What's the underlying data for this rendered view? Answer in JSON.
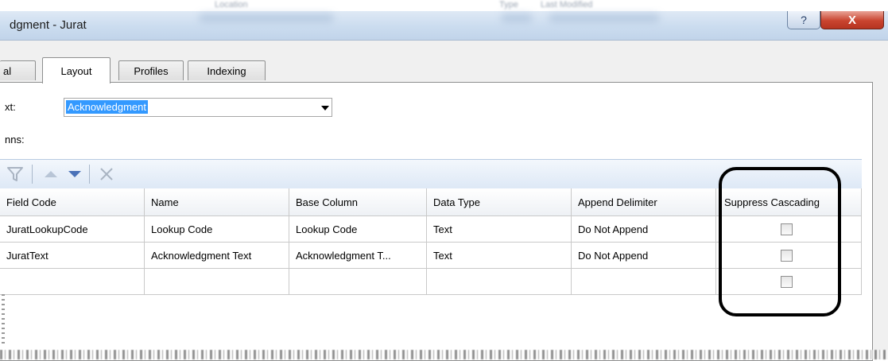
{
  "background_header": [
    "Location",
    "Type",
    "Last Modified"
  ],
  "window": {
    "title": "dgment - Jurat",
    "help_symbol": "?",
    "close_symbol": "X"
  },
  "tabs": [
    {
      "label": "al"
    },
    {
      "label": "Layout",
      "active": true
    },
    {
      "label": "Profiles"
    },
    {
      "label": "Indexing"
    }
  ],
  "form": {
    "text_label": "xt:",
    "text_value": "Acknowledgment",
    "columns_label": "nns:"
  },
  "grid": {
    "headers": [
      "Field Code",
      "Name",
      "Base Column",
      "Data Type",
      "Append Delimiter",
      "Suppress Cascading"
    ],
    "rows": [
      {
        "field_code": "JuratLookupCode",
        "name": "Lookup Code",
        "base_column": "Lookup Code",
        "data_type": "Text",
        "append_delimiter": "Do Not Append",
        "suppress_cascading": false
      },
      {
        "field_code": "JuratText",
        "name": "Acknowledgment Text",
        "base_column": "Acknowledgment T...",
        "data_type": "Text",
        "append_delimiter": "Do Not Append",
        "suppress_cascading": false
      },
      {
        "field_code": "",
        "name": "",
        "base_column": "",
        "data_type": "",
        "append_delimiter": "",
        "suppress_cascading": false
      }
    ]
  },
  "colors": {
    "selection": "#3399ff",
    "titlebar": "#cbdcef",
    "close": "#c9442f",
    "annotation": "#000000"
  },
  "icons": [
    "filter-icon",
    "move-up-icon",
    "move-down-icon",
    "delete-icon"
  ]
}
